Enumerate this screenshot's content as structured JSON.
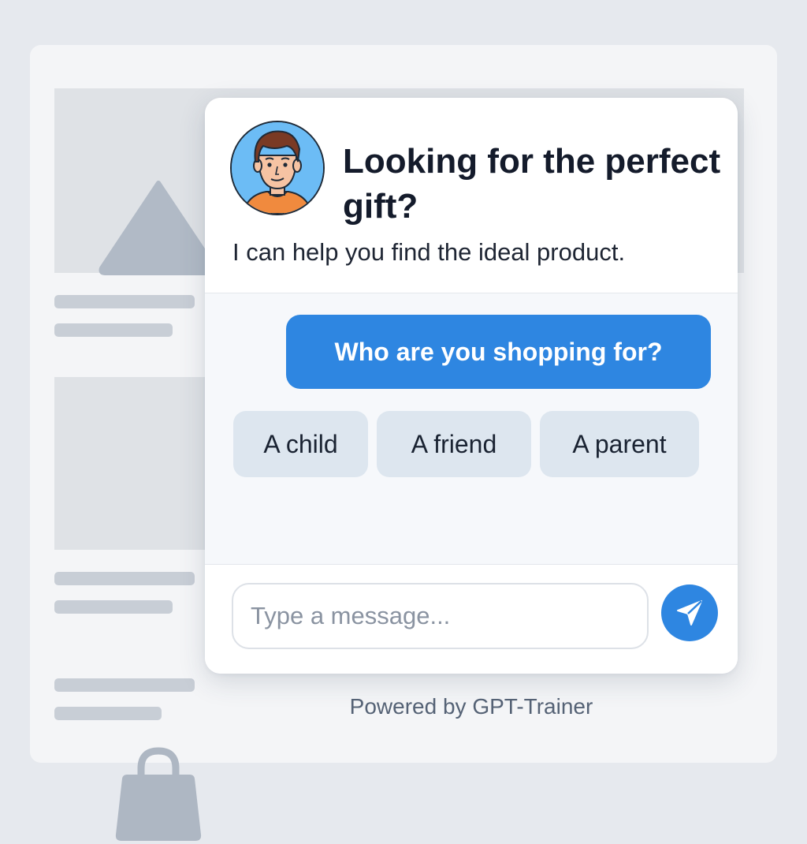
{
  "chat": {
    "title": "Looking for the perfect gift?",
    "subtitle": "I can help you find the ideal product.",
    "bot_message": "Who are you shopping for?",
    "quick_replies": [
      "A child",
      "A friend",
      "A parent"
    ],
    "input_placeholder": "Type a message...",
    "send_icon": "paper-plane-icon",
    "avatar_icon": "avatar-man-icon"
  },
  "footer": {
    "powered_by": "Powered by GPT-Trainer"
  },
  "background_page": {
    "placeholder_icons": [
      "triangle-icon",
      "shopping-bag-icon"
    ]
  },
  "colors": {
    "accent": "#2e86e1",
    "quick_reply_bg": "#dde6ef",
    "text_primary": "#141b2b",
    "avatar_bg": "#6cbcf5"
  }
}
